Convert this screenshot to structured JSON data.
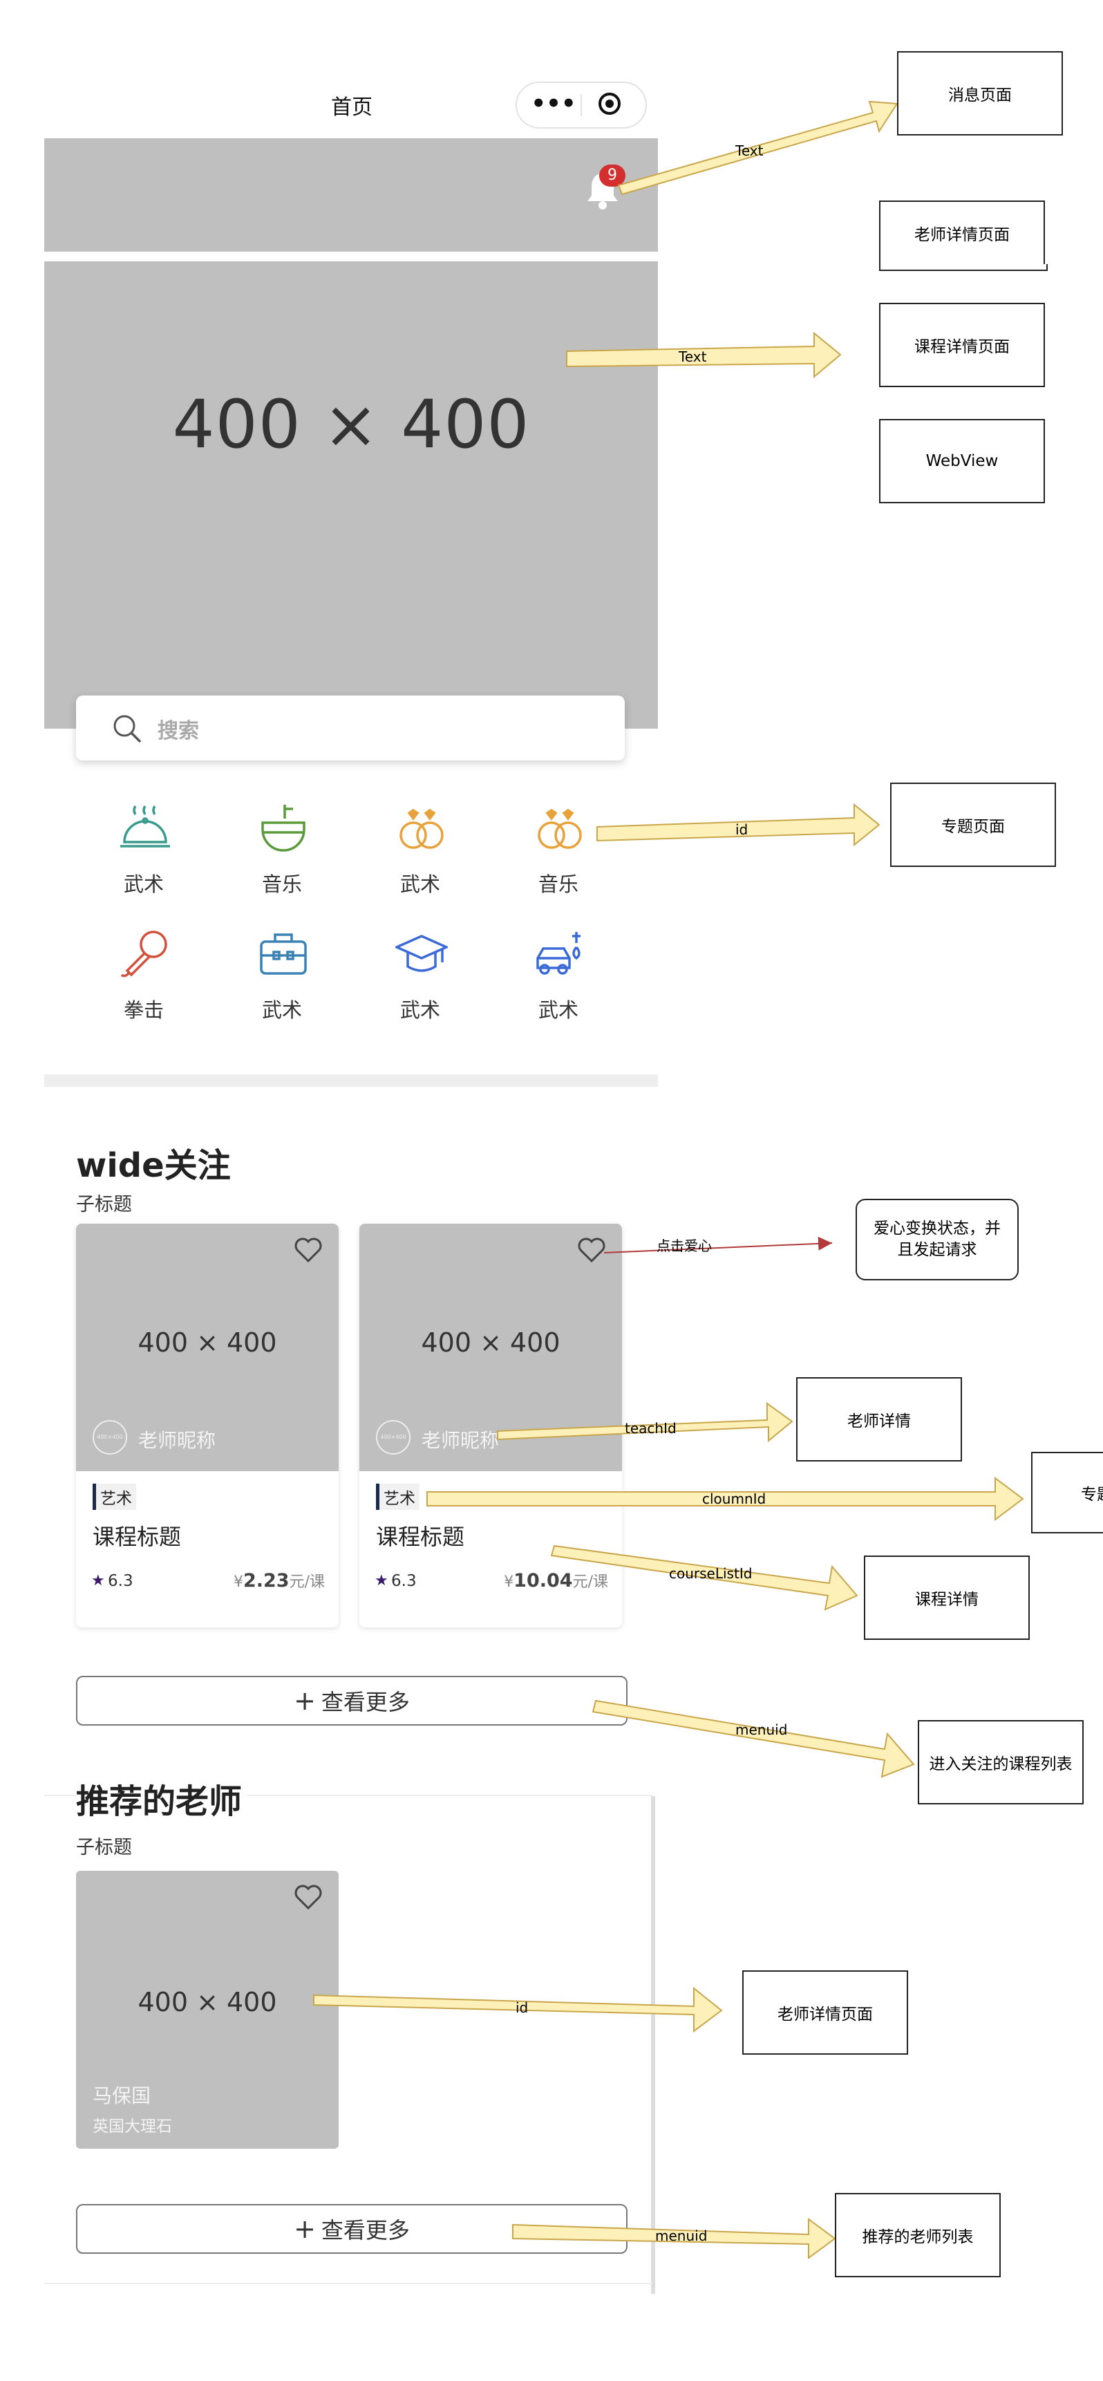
{
  "nav": {
    "title": "首页",
    "dots": "•••",
    "badge_count": "9"
  },
  "banner": {
    "placeholder": "400 × 400"
  },
  "search": {
    "placeholder": "搜索"
  },
  "categories": [
    {
      "label": "武术",
      "icon": "food-cover-icon"
    },
    {
      "label": "音乐",
      "icon": "pot-icon"
    },
    {
      "label": "武术",
      "icon": "rings-icon"
    },
    {
      "label": "音乐",
      "icon": "rings-icon"
    },
    {
      "label": "拳击",
      "icon": "microphone-icon"
    },
    {
      "label": "武术",
      "icon": "briefcase-icon"
    },
    {
      "label": "武术",
      "icon": "graduation-cap-icon"
    },
    {
      "label": "武术",
      "icon": "car-wash-icon"
    }
  ],
  "wide": {
    "title": "wide关注",
    "subtitle": "子标题",
    "cards": [
      {
        "image": "400 × 400",
        "avatar": "400×400",
        "teacher": "老师昵称",
        "tag": "艺术",
        "course": "课程标题",
        "rating": "6.3",
        "yen": "¥",
        "price": "2.23",
        "unit": "元/课"
      },
      {
        "image": "400 × 400",
        "avatar": "400×400",
        "teacher": "老师昵称",
        "tag": "艺术",
        "course": "课程标题",
        "rating": "6.3",
        "yen": "¥",
        "price": "10.04",
        "unit": "元/课"
      }
    ],
    "more": "查看更多"
  },
  "recommend": {
    "title": "推荐的老师",
    "subtitle": "子标题",
    "card": {
      "image": "400 × 400",
      "name": "马保国",
      "desc": "英国大理石"
    },
    "more": "查看更多"
  },
  "annotations": {
    "boxes": {
      "message_page": "消息页面",
      "teacher_detail_page_top": "老师详情页面",
      "course_detail_page": "课程详情页面",
      "webview": "WebView",
      "topic_page": "专题页面",
      "heart_toggle": "爱心变换状态，并且发起请求",
      "teacher_detail": "老师详情",
      "topic_cut": "专题",
      "course_detail": "课程详情",
      "followed_course_list": "进入关注的课程列表",
      "teacher_detail_page_bottom": "老师详情页面",
      "recommended_teacher_list": "推荐的老师列表"
    },
    "labels": {
      "bell_text": "Text",
      "banner_text": "Text",
      "category_id": "id",
      "click_heart": "点击爱心",
      "teach_id": "teachId",
      "cloumn_id": "cloumnId",
      "course_list_id": "courseListId",
      "menu_id_1": "menuid",
      "teacher_id": "id",
      "menu_id_2": "menuid"
    },
    "colors": {
      "arrow_fill": "#fdf0b8",
      "arrow_stroke": "#c9a64a",
      "heart_arrow": "#b03a3a",
      "badge": "#d32f2f"
    }
  }
}
